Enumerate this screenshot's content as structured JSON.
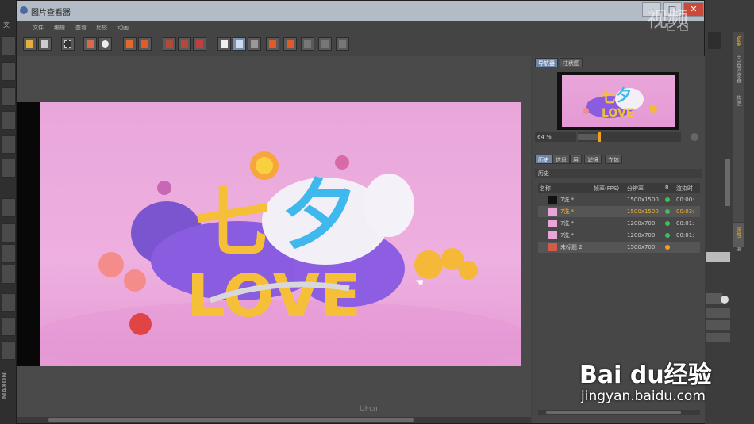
{
  "window": {
    "title": "图片查看器"
  },
  "background_app": {
    "left_label": "文",
    "vertical_label": "MAXON",
    "right_tabs": [
      "对象",
      "内容浏览器",
      "构造",
      "属性",
      "层"
    ]
  },
  "menu": [
    "文件",
    "编辑",
    "查看",
    "比较",
    "动画"
  ],
  "navigator": {
    "tabs": [
      "导航器",
      "柱状图"
    ],
    "zoom": "64 %"
  },
  "history": {
    "tabs": [
      "历史",
      "信息",
      "层",
      "滤镜",
      "立体"
    ],
    "header": "历史",
    "columns": [
      "名称",
      "帧率(FPS)",
      "分辨率",
      "R",
      "渲染时"
    ],
    "rows": [
      {
        "name": "7洗 *",
        "res": "1500x1500",
        "time": "00:00:",
        "status": "#3fbf5a",
        "highlight": false,
        "thumb": "#111"
      },
      {
        "name": "7洗 *",
        "res": "1500x1500",
        "time": "00:03:",
        "status": "#3fbf5a",
        "highlight": true,
        "thumb": "#e7a6d8"
      },
      {
        "name": "7洗 *",
        "res": "1200x700",
        "time": "00:01:",
        "status": "#3fbf5a",
        "highlight": false,
        "thumb": "#e7a6d8"
      },
      {
        "name": "7洗 *",
        "res": "1200x700",
        "time": "00:01:",
        "status": "#3fbf5a",
        "highlight": false,
        "thumb": "#e7a6d8"
      },
      {
        "name": "未标题 2",
        "res": "1500x700",
        "time": "",
        "status": "#f0a020",
        "highlight": false,
        "thumb": "#d45a4a"
      }
    ]
  },
  "image": {
    "word1": "七夕",
    "word2": "LOVE"
  },
  "overlays": {
    "logo": "视频",
    "watermark": "UI·cn",
    "baidu": "Bai du经验",
    "baidu_url": "jingyan.baidu.com"
  },
  "colors": {
    "accent": "#6d86a8",
    "highlight_text": "#f0b030"
  }
}
